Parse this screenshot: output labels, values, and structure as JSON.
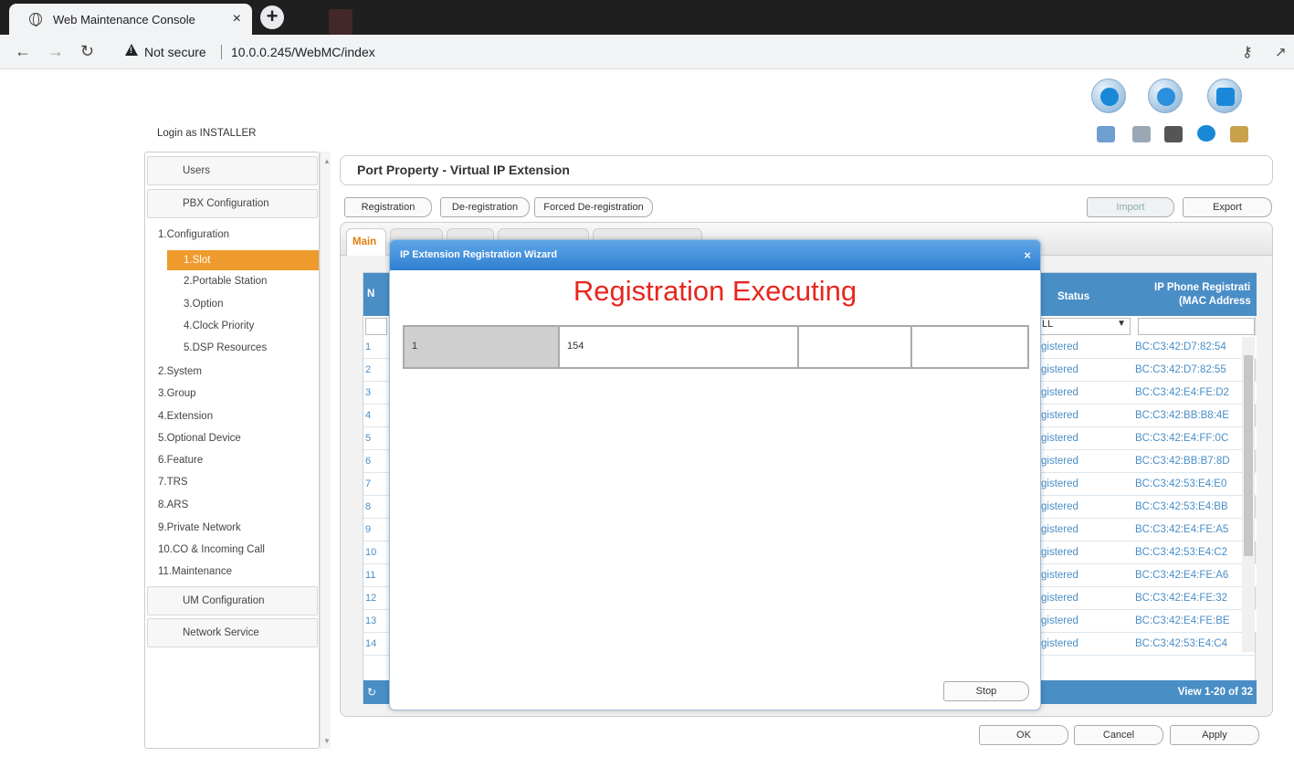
{
  "browser": {
    "tab_title": "Web Maintenance Console",
    "tab_close": "×",
    "new_tab": "+",
    "security_label": "Not secure",
    "url": "10.0.0.245/WebMC/index"
  },
  "header": {
    "login_text": "Login as INSTALLER",
    "icons": [
      "home-icon",
      "tool-icon",
      "settings-icon",
      "calendar-icon",
      "phone-icon",
      "save-icon",
      "info-icon",
      "logout-icon"
    ]
  },
  "sidebar": {
    "users": "Users",
    "pbx": "PBX Configuration",
    "section": "1.Configuration",
    "sub_items": [
      "1.Slot",
      "2.Portable Station",
      "3.Option",
      "4.Clock Priority",
      "5.DSP Resources"
    ],
    "items": [
      "2.System",
      "3.Group",
      "4.Extension",
      "5.Optional Device",
      "6.Feature",
      "7.TRS",
      "8.ARS",
      "9.Private Network",
      "10.CO & Incoming Call",
      "11.Maintenance"
    ],
    "um": "UM Configuration",
    "network": "Network Service"
  },
  "main": {
    "title": "Port Property - Virtual IP Extension",
    "buttons": {
      "registration": "Registration",
      "deregistration": "De-registration",
      "forced": "Forced De-registration",
      "import": "Import",
      "export": "Export"
    },
    "tab_main": "Main",
    "col_no": "N",
    "col_status": "Status",
    "col_mac_1": "IP Phone Registrati",
    "col_mac_2": "(MAC Address",
    "filter_value": "LL",
    "rows": [
      {
        "n": "1",
        "status": "gistered",
        "mac": "BC:C3:42:D7:82:54"
      },
      {
        "n": "2",
        "status": "gistered",
        "mac": "BC:C3:42:D7:82:55"
      },
      {
        "n": "3",
        "status": "gistered",
        "mac": "BC:C3:42:E4:FE:D2"
      },
      {
        "n": "4",
        "status": "gistered",
        "mac": "BC:C3:42:BB:B8:4E"
      },
      {
        "n": "5",
        "status": "gistered",
        "mac": "BC:C3:42:E4:FF:0C"
      },
      {
        "n": "6",
        "status": "gistered",
        "mac": "BC:C3:42:BB:B7:8D"
      },
      {
        "n": "7",
        "status": "gistered",
        "mac": "BC:C3:42:53:E4:E0"
      },
      {
        "n": "8",
        "status": "gistered",
        "mac": "BC:C3:42:53:E4:BB"
      },
      {
        "n": "9",
        "status": "gistered",
        "mac": "BC:C3:42:E4:FE:A5"
      },
      {
        "n": "10",
        "status": "gistered",
        "mac": "BC:C3:42:53:E4:C2"
      },
      {
        "n": "11",
        "status": "gistered",
        "mac": "BC:C3:42:E4:FE:A6"
      },
      {
        "n": "12",
        "status": "gistered",
        "mac": "BC:C3:42:E4:FE:32"
      },
      {
        "n": "13",
        "status": "gistered",
        "mac": "BC:C3:42:E4:FE:BE"
      },
      {
        "n": "14",
        "status": "gistered",
        "mac": "BC:C3:42:53:E4:C4"
      }
    ],
    "view_text": "View 1-20 of 32"
  },
  "modal": {
    "title": "IP Extension Registration Wizard",
    "close": "×",
    "heading": "Registration Executing",
    "row": [
      "1",
      "154",
      "",
      ""
    ],
    "stop": "Stop"
  },
  "footer": {
    "ok": "OK",
    "cancel": "Cancel",
    "apply": "Apply"
  }
}
